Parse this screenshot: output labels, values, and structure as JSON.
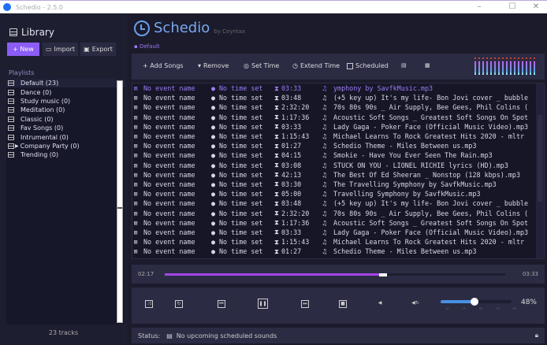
{
  "window": {
    "title": "Schedio - 2.5.0",
    "minimize": "–",
    "maximize": "☐",
    "close": "✕"
  },
  "sidebar": {
    "title": "Library",
    "new_label": "+ New",
    "import_label": "Import",
    "export_label": "Export",
    "playlists_label": "Playlists",
    "playlists": [
      {
        "label": "Default (23)"
      },
      {
        "label": "Dance (0)"
      },
      {
        "label": "Study music (0)"
      },
      {
        "label": "Meditation (0)"
      },
      {
        "label": "Classic (0)"
      },
      {
        "label": "Fav Songs (0)"
      },
      {
        "label": "Intrumental (0)"
      },
      {
        "label": "Company Party (0)"
      },
      {
        "label": "Trending (0)"
      }
    ],
    "track_count": "23 tracks"
  },
  "header": {
    "app_name": "Schedio",
    "by": "by Ceyntax",
    "playlist": "Default"
  },
  "toolbar": {
    "add": "+ Add Songs",
    "remove": "Remove",
    "set_time": "Set Time",
    "extend_time": "Extend Time",
    "scheduled": "Scheduled"
  },
  "tracks": [
    {
      "event": "No event name",
      "time": "No time set",
      "duration": "03:33",
      "file": "ymphony by SavfkMusic.mp3",
      "playing": true
    },
    {
      "event": "No event name",
      "time": "No time set",
      "duration": "03:48",
      "file": "(+5 key up) It's my life- Bon Jovi cover _ bubble"
    },
    {
      "event": "No event name",
      "time": "No time set",
      "duration": "2:32:20",
      "file": "70s 80s 90s _ Air Supply, Bee Gees, Phil Colins ("
    },
    {
      "event": "No event name",
      "time": "No time set",
      "duration": "1:17:36",
      "file": "Acoustic Soft Songs _ Greatest Soft Songs On Spot"
    },
    {
      "event": "No event name",
      "time": "No time set",
      "duration": "03:33",
      "file": "Lady Gaga - Poker Face (Official Music Video).mp3"
    },
    {
      "event": "No event name",
      "time": "No time set",
      "duration": "1:15:43",
      "file": "Michael Learns To Rock Greatest Hits 2020 - mltr"
    },
    {
      "event": "No event name",
      "time": "No time set",
      "duration": "01:27",
      "file": "Schedio Theme - Miles Between us.mp3"
    },
    {
      "event": "No event name",
      "time": "No time set",
      "duration": "04:15",
      "file": "Smokie - Have You Ever Seen The Rain.mp3"
    },
    {
      "event": "No event name",
      "time": "No time set",
      "duration": "03:08",
      "file": "STUCK ON YOU  - LIONEL RICHIE lyrics (HD).mp3"
    },
    {
      "event": "No event name",
      "time": "No time set",
      "duration": "42:13",
      "file": "The Best Of Ed Sheeran _ Nonstop (128 kbps).mp3"
    },
    {
      "event": "No event name",
      "time": "No time set",
      "duration": "03:30",
      "file": "The Travelling Symphony by SavfkMusic.mp3"
    },
    {
      "event": "No event name",
      "time": "No time set",
      "duration": "05:00",
      "file": "Travelling Symphony by SavfkMusic.mp3"
    },
    {
      "event": "No event name",
      "time": "No time set",
      "duration": "03:48",
      "file": "(+5 key up) It's my life- Bon Jovi cover _ bubble"
    },
    {
      "event": "No event name",
      "time": "No time set",
      "duration": "2:32:20",
      "file": "70s 80s 90s _ Air Supply, Bee Gees, Phil Colins ("
    },
    {
      "event": "No event name",
      "time": "No time set",
      "duration": "1:17:36",
      "file": "Acoustic Soft Songs _ Greatest Soft Songs On Spot"
    },
    {
      "event": "No event name",
      "time": "No time set",
      "duration": "03:33",
      "file": "Lady Gaga - Poker Face (Official Music Video).mp3"
    },
    {
      "event": "No event name",
      "time": "No time set",
      "duration": "1:15:43",
      "file": "Michael Learns To Rock Greatest Hits 2020 - mltr"
    },
    {
      "event": "No event name",
      "time": "No time set",
      "duration": "01:27",
      "file": "Schedio Theme - Miles Between us.mp3"
    }
  ],
  "player": {
    "elapsed": "02:17",
    "total": "03:33",
    "progress": 0.64,
    "volume_percent": 48,
    "volume_label": "48%",
    "volume_ticks": [
      "10",
      "25",
      "50",
      "75",
      "90"
    ]
  },
  "status": {
    "label": "Status:",
    "text": "No upcoming scheduled sounds"
  }
}
